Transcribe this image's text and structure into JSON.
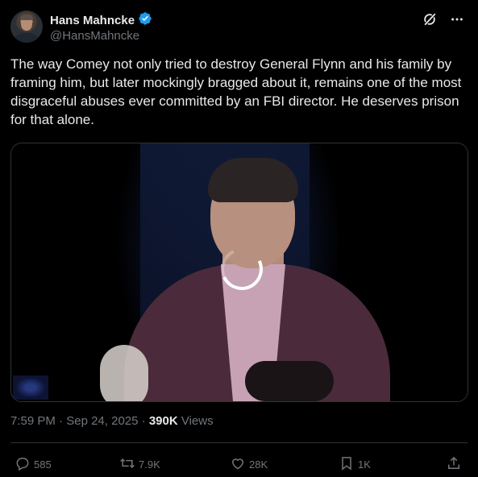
{
  "author": {
    "display_name": "Hans Mahncke",
    "handle": "@HansMahncke",
    "verified": true
  },
  "tweet": {
    "text": "The way Comey not only tried to destroy General Flynn and his family by framing him, but later mockingly bragged about it, remains one of the most disgraceful abuses ever committed by an FBI director. He deserves prison for that alone."
  },
  "meta": {
    "time": "7:59 PM",
    "separator1": " · ",
    "date": "Sep 24, 2025",
    "separator2": " · ",
    "views_count": "390K",
    "views_label": " Views"
  },
  "actions": {
    "replies": "585",
    "reposts": "7.9K",
    "likes": "28K",
    "bookmarks": "1K"
  },
  "colors": {
    "background": "#000000",
    "text": "#e7e9ea",
    "muted": "#71767b",
    "verified": "#1d9bf0",
    "divider": "#2f3336"
  },
  "icons": {
    "verified": "verified-badge-icon",
    "grok": "grok-icon",
    "more": "more-icon",
    "reply": "reply-icon",
    "repost": "repost-icon",
    "like": "like-icon",
    "bookmark": "bookmark-icon",
    "share": "share-icon"
  }
}
